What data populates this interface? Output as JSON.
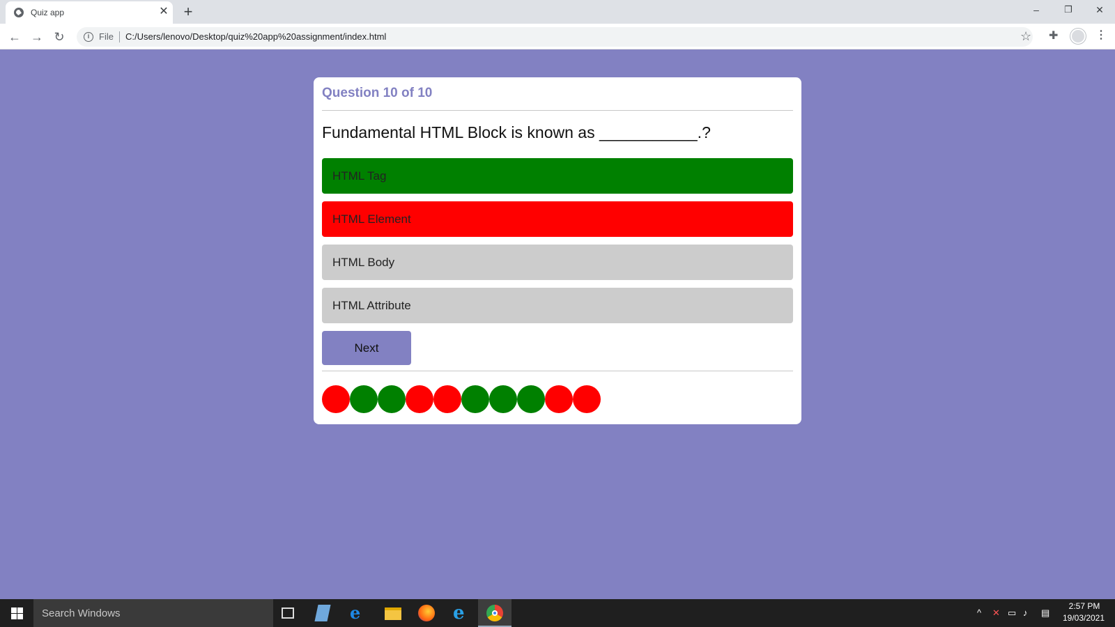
{
  "browser": {
    "tab_title": "Quiz app",
    "tab_close": "✕",
    "new_tab": "+",
    "file_label": "File",
    "url": "C:/Users/lenovo/Desktop/quiz%20app%20assignment/index.html",
    "window_controls": {
      "minimize": "–",
      "restore": "❐",
      "close": "✕"
    },
    "nav": {
      "back": "←",
      "forward": "→",
      "reload": "↻"
    },
    "icons": [
      "info-icon",
      "star-icon",
      "extensions-icon",
      "profile-icon",
      "menu-icon"
    ]
  },
  "quiz": {
    "counter": "Question 10 of 10",
    "question": "Fundamental HTML Block is known as ___________.?",
    "options": [
      {
        "label": "HTML Tag",
        "state": "correct",
        "color": "#008000"
      },
      {
        "label": "HTML Element",
        "state": "wrong",
        "color": "#ff0000"
      },
      {
        "label": "HTML Body",
        "state": "neutral",
        "color": "#cccccc"
      },
      {
        "label": "HTML Attribute",
        "state": "neutral",
        "color": "#cccccc"
      }
    ],
    "next_label": "Next",
    "results": [
      "wrong",
      "correct",
      "correct",
      "wrong",
      "wrong",
      "correct",
      "correct",
      "correct",
      "wrong",
      "wrong"
    ],
    "colors": {
      "accent": "#8281c2",
      "correct": "#008000",
      "wrong": "#ff0000",
      "neutral": "#cccccc"
    }
  },
  "taskbar": {
    "search_placeholder": "Search Windows",
    "time": "2:57 PM",
    "date": "19/03/2021",
    "apps": [
      "task-view-icon",
      "notepad-icon",
      "edge-icon",
      "file-explorer-icon",
      "firefox-icon",
      "internet-explorer-icon",
      "chrome-icon"
    ]
  }
}
